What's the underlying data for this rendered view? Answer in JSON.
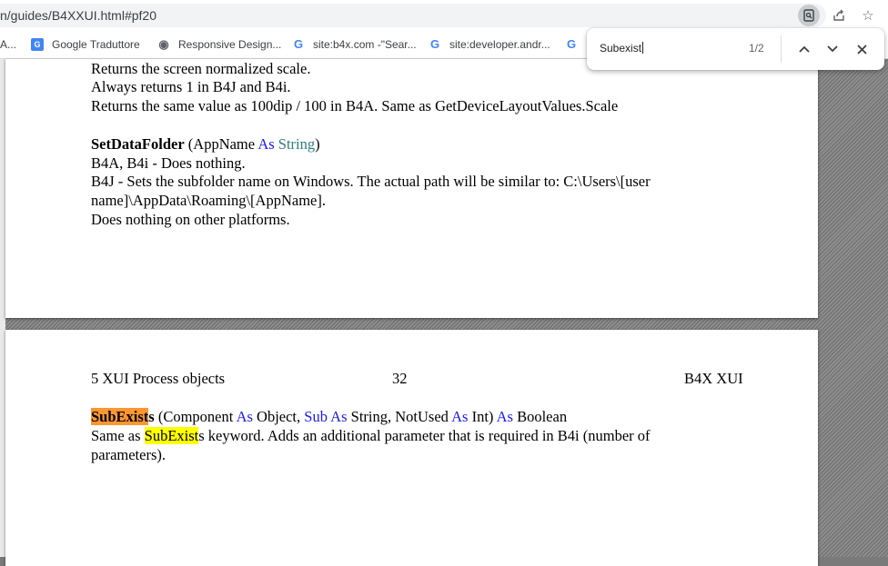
{
  "browser": {
    "url": "n/guides/B4XXUI.html#pf20",
    "icons": [
      "search-page-icon",
      "share-icon",
      "star-icon"
    ]
  },
  "bookmarks": [
    {
      "label": "A...",
      "icon": "none"
    },
    {
      "label": "Google Traduttore",
      "icon": "google-translate-icon"
    },
    {
      "label": "Responsive Design...",
      "icon": "globe-icon"
    },
    {
      "label": "site:b4x.com -\"Sear...",
      "icon": "google-icon"
    },
    {
      "label": "site:developer.andr...",
      "icon": "google-icon"
    }
  ],
  "find_bar": {
    "query": "Subexist",
    "count": "1/2",
    "prev_icon": "chevron-up-icon",
    "next_icon": "chevron-down-icon",
    "close_icon": "close-icon"
  },
  "page1": {
    "line1": "Returns the screen normalized scale.",
    "line2": "Always returns 1 in B4J and B4i.",
    "line3": "Returns the same value as 100dip / 100 in B4A. Same as GetDeviceLayoutValues.Scale",
    "sig_name": "SetDataFolder",
    "sig_open": " (AppName ",
    "sig_as": "As",
    "sig_type": " String",
    "sig_close": ")",
    "line5": "B4A, B4i - Does nothing.",
    "line6": "B4J - Sets the subfolder name on Windows. The actual path will be similar to: C:\\Users\\[user",
    "line7": "name]\\AppData\\Roaming\\[AppName].",
    "line8": "Does nothing on other platforms."
  },
  "page2": {
    "header_left": "5  XUI Process objects",
    "header_center": "32",
    "header_right": "B4X XUI",
    "sig_name_hl": "SubExist",
    "sig_name_rest": "s",
    "sig_p1": " (Component ",
    "as1": "As",
    "sig_p2": " Object, ",
    "sub": "Sub",
    "sig_p3": " ",
    "as2": "As",
    "sig_p4": " String, NotUsed ",
    "as3": "As",
    "sig_p5": " Int) ",
    "as4": "As",
    "sig_p6": " Boolean",
    "desc_pre": "Same as ",
    "desc_hl": "SubExist",
    "desc_post": "s keyword. Adds an additional parameter that is required in B4i (number of",
    "desc_line2": "parameters)."
  },
  "colors": {
    "keyword": "#1a1aff",
    "type": "#2b8080",
    "current_match": "#ff9632",
    "other_match": "#ffff00"
  }
}
